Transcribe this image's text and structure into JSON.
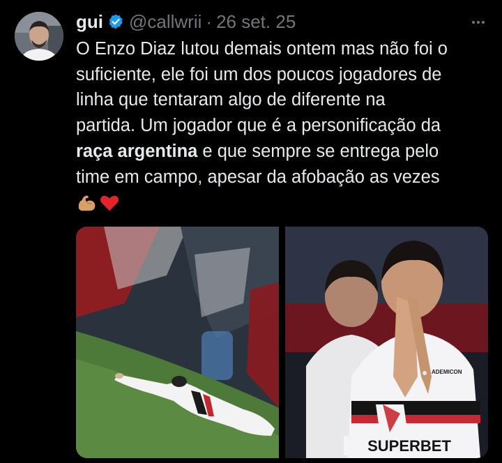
{
  "tweet": {
    "author_name": "gui",
    "handle": "@callwrii",
    "separator": "·",
    "date": "26 set. 25",
    "lines": [
      "O Enzo Diaz lutou demais ontem mas não foi o",
      "suficiente, ele foi um dos poucos jogadores de",
      "linha que tentaram algo de diferente na",
      "partida. Um jogador que é a personificação da"
    ],
    "line5_bold": "raça argentina",
    "line5_rest": " e que sempre se entrega pelo",
    "line6": "time em campo, apesar da afobação as vezes",
    "emojis": [
      "flexed-biceps-emoji",
      "red-heart-emoji"
    ],
    "photo2_sponsor": "SUPERBET",
    "photo2_badge": "ADEMICON",
    "colors": {
      "background": "#000000",
      "text": "#e7e9ea",
      "muted": "#71767b",
      "verified": "#1d9bf0"
    }
  }
}
